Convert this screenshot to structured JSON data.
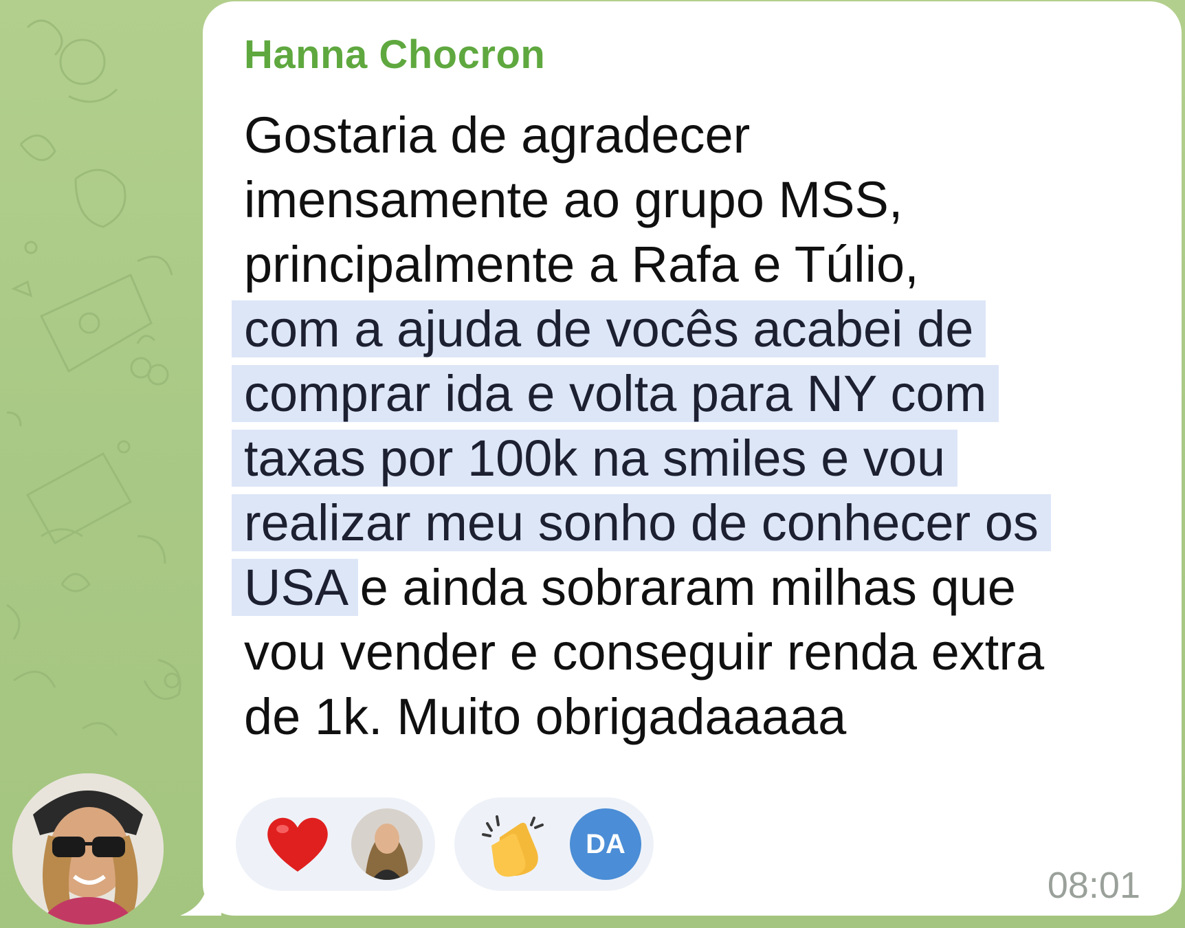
{
  "message": {
    "sender": "Hanna Chocron",
    "lines": [
      {
        "text": "Gostaria de agradecer",
        "highlighted": false
      },
      {
        "text": "imensamente ao grupo MSS,",
        "highlighted": false
      },
      {
        "text": "principalmente a Rafa e Túlio,",
        "highlighted": false
      },
      {
        "text": "com a ajuda de vocês acabei de",
        "highlighted": true
      },
      {
        "text": "comprar ida e volta para NY com",
        "highlighted": true
      },
      {
        "text": "taxas por 100k na smiles e vou",
        "highlighted": true
      },
      {
        "text": "realizar meu sonho de conhecer os",
        "highlighted": true
      }
    ],
    "line8_highlighted": "USA",
    "line8_rest": " e ainda sobraram milhas que",
    "line9": "vou vender e conseguir renda extra",
    "line10": "de 1k. Muito obrigadaaaaa",
    "time": "08:01",
    "highlight_color": "#dde6f7",
    "sender_color": "#5fa83f"
  },
  "reactions": [
    {
      "emoji": "heart-emoji",
      "reactor": "user-photo"
    },
    {
      "emoji": "clapping-hands-emoji",
      "reactor_initials": "DA"
    }
  ]
}
